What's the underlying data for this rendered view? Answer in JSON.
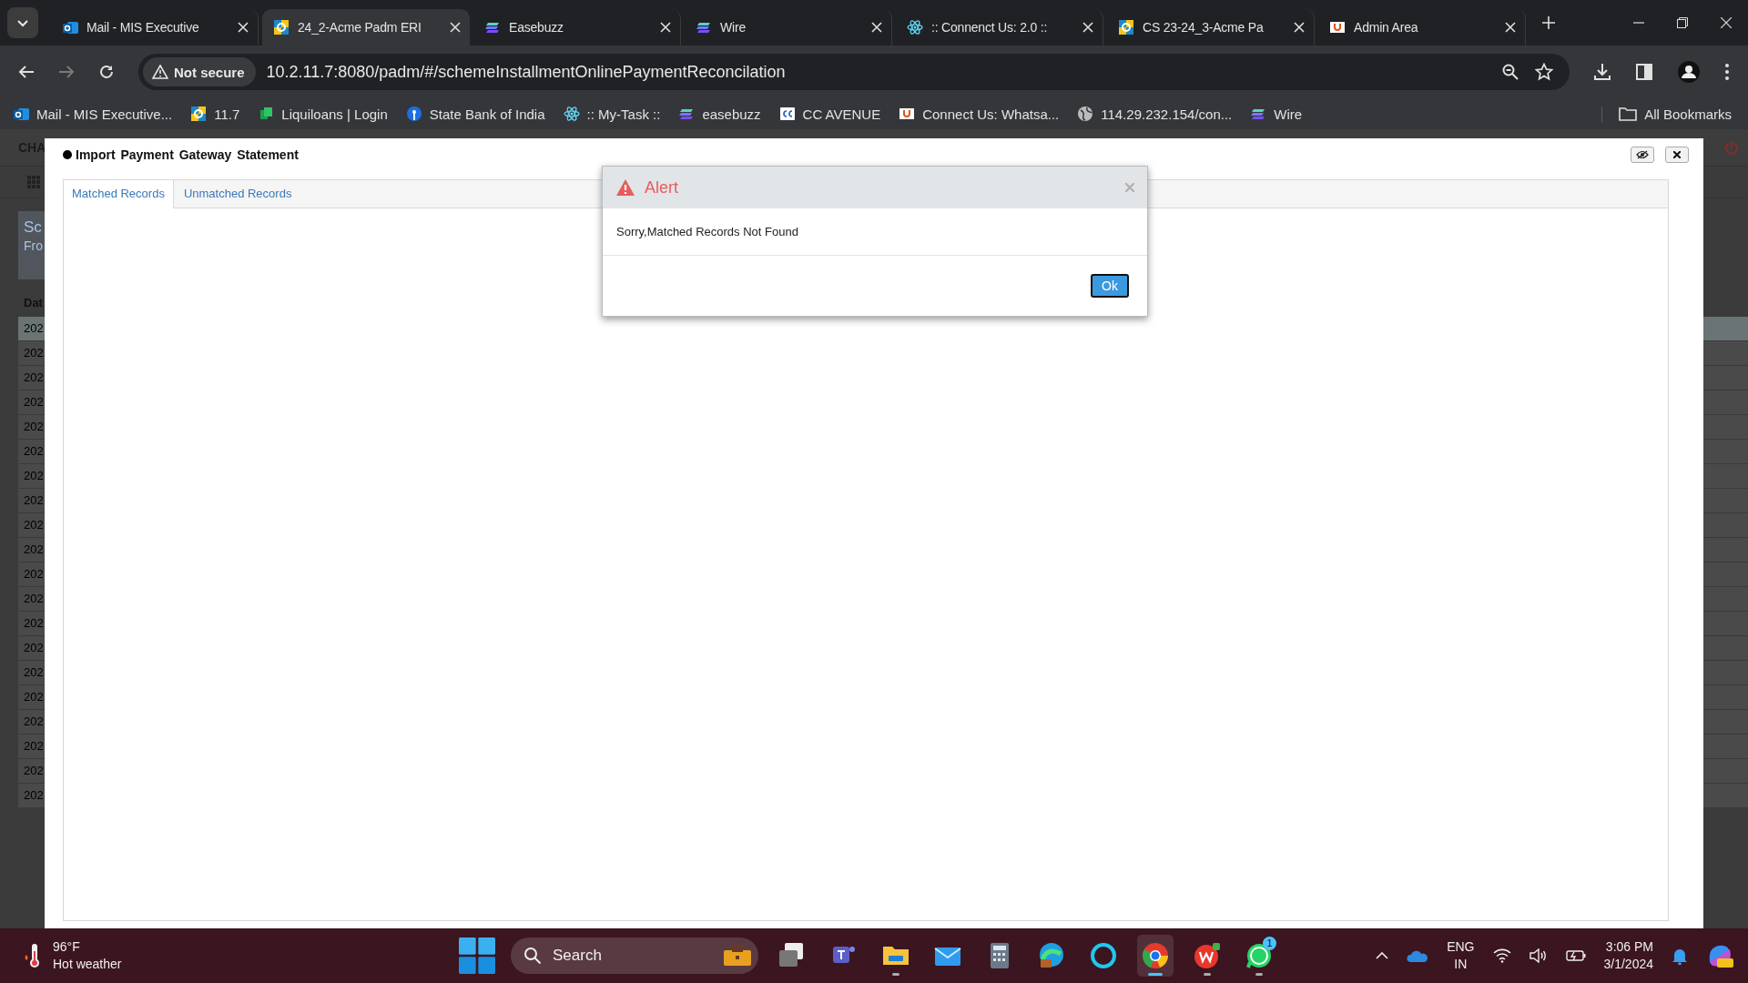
{
  "browser": {
    "tabs": [
      {
        "kind": "outlook",
        "title": "Mail - MIS Executive",
        "selected": false
      },
      {
        "kind": "erp",
        "title": "24_2-Acme Padm ERI",
        "selected": true
      },
      {
        "kind": "easebuzz",
        "title": "Easebuzz",
        "selected": false
      },
      {
        "kind": "easebuzz",
        "title": "Wire",
        "selected": false
      },
      {
        "kind": "react",
        "title": ":: Connenct Us: 2.0 ::",
        "selected": false
      },
      {
        "kind": "erp",
        "title": "CS 23-24_3-Acme Pa",
        "selected": false
      },
      {
        "kind": "connectus",
        "title": "Admin Area",
        "selected": false
      }
    ],
    "security": "Not secure",
    "url": "10.2.11.7:8080/padm/#/schemeInstallmentOnlinePaymentReconcilation",
    "bookmarks": [
      {
        "kind": "outlook",
        "title": "Mail - MIS Executive..."
      },
      {
        "kind": "erp",
        "title": "11.7"
      },
      {
        "kind": "liquiloans",
        "title": "Liquiloans | Login"
      },
      {
        "kind": "sbi",
        "title": "State Bank of India"
      },
      {
        "kind": "react",
        "title": ":: My-Task ::"
      },
      {
        "kind": "easebuzz",
        "title": "easebuzz"
      },
      {
        "kind": "cc",
        "title": "CC AVENUE"
      },
      {
        "kind": "connectus",
        "title": "Connect Us: Whatsa..."
      },
      {
        "kind": "globe",
        "title": "114.29.232.154/con..."
      },
      {
        "kind": "easebuzz",
        "title": "Wire"
      }
    ],
    "all_bookmarks": "All Bookmarks"
  },
  "background_app": {
    "header": "CHA",
    "panel_title": "Sc",
    "panel_subtitle": "Fro",
    "column": "Dat",
    "rows": [
      {
        "text": "202",
        "selected": true
      },
      {
        "text": "202",
        "selected": false
      },
      {
        "text": "202",
        "selected": false
      },
      {
        "text": "202",
        "selected": false
      },
      {
        "text": "202",
        "selected": false
      },
      {
        "text": "202",
        "selected": false
      },
      {
        "text": "202",
        "selected": false
      },
      {
        "text": "202",
        "selected": false
      },
      {
        "text": "202",
        "selected": false
      },
      {
        "text": "202",
        "selected": false
      },
      {
        "text": "202",
        "selected": false
      },
      {
        "text": "202",
        "selected": false
      },
      {
        "text": "202",
        "selected": false
      },
      {
        "text": "202",
        "selected": false
      },
      {
        "text": "202",
        "selected": false
      },
      {
        "text": "202",
        "selected": false
      },
      {
        "text": "202",
        "selected": false
      },
      {
        "text": "202",
        "selected": false
      },
      {
        "text": "202",
        "selected": false
      },
      {
        "text": "202",
        "selected": false
      }
    ]
  },
  "modal": {
    "title": "Import Payment Gateway Statement",
    "tabs": [
      {
        "label": "Matched Records",
        "selected": true
      },
      {
        "label": "Unmatched Records",
        "selected": false
      }
    ]
  },
  "alert": {
    "title": "Alert",
    "message": "Sorry,Matched Records Not Found",
    "button": "Ok"
  },
  "taskbar": {
    "temperature": "96°F",
    "weather": "Hot weather",
    "search": "Search",
    "apps": [
      {
        "kind": "taskview",
        "running": false,
        "selected": false
      },
      {
        "kind": "teams",
        "running": false,
        "selected": false
      },
      {
        "kind": "folder",
        "running": true,
        "selected": false
      },
      {
        "kind": "mail",
        "running": false,
        "selected": false
      },
      {
        "kind": "calculator",
        "running": false,
        "selected": false
      },
      {
        "kind": "edge",
        "running": false,
        "selected": false
      },
      {
        "kind": "ring",
        "running": false,
        "selected": false
      },
      {
        "kind": "chrome",
        "running": true,
        "selected": true
      },
      {
        "kind": "wps",
        "running": true,
        "selected": false
      },
      {
        "kind": "whatsapp",
        "running": true,
        "selected": false,
        "badge": "1"
      }
    ],
    "language": "ENG",
    "region": "IN",
    "time": "3:06 PM",
    "date": "3/1/2024"
  }
}
